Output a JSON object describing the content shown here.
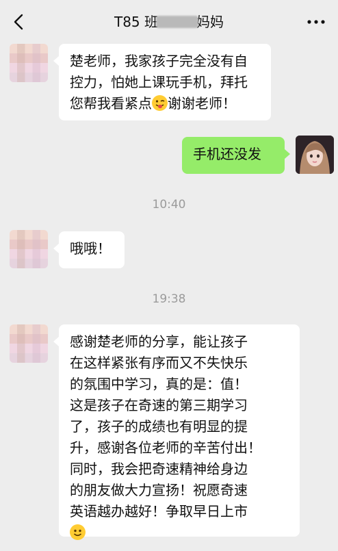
{
  "header": {
    "title_prefix": "T85 班",
    "title_suffix": "妈妈"
  },
  "messages": [
    {
      "side": "left",
      "text": "楚老师，我家孩子完全没有自\n控力，怕她上课玩手机，拜托\n您帮我看紧点",
      "text_after_emoji": "谢谢老师！",
      "emoji": "winking-tongue-emoji"
    },
    {
      "side": "right",
      "text": "手机还没发"
    },
    {
      "type": "time",
      "text": "10:40"
    },
    {
      "side": "left",
      "text": "哦哦！"
    },
    {
      "type": "time",
      "text": "19:38"
    },
    {
      "side": "left",
      "text": "感谢楚老师的分享，能让孩子\n在这样紧张有序而又不失快乐\n的氛围中学习，真的是：值！\n这是孩子在奇速的第三期学习\n了，孩子的成绩也有明显的提\n升，感谢各位老师的辛苦付出！\n同时，我会把奇速精神给身边\n的朋友做大力宣扬！祝愿奇速\n英语越办越好！争取早日上市",
      "emoji": "smile-emoji"
    }
  ],
  "colors": {
    "background": "#ededed",
    "bubble_left": "#ffffff",
    "bubble_right": "#95ec69",
    "timestamp": "#9b9b9b"
  }
}
